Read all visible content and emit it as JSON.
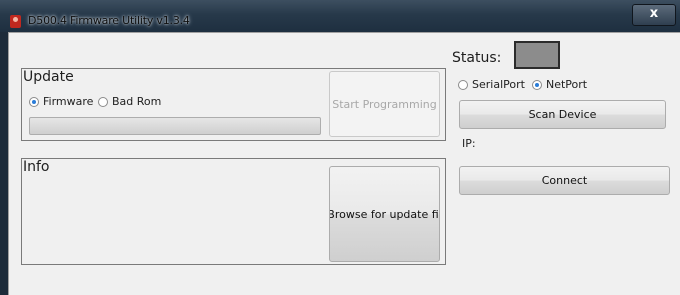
{
  "window": {
    "title": "D500.4 Firmware Utility v1.3.4",
    "close_glyph": "x"
  },
  "update": {
    "title": "Update",
    "radios": [
      {
        "label": "Firmware",
        "selected": true
      },
      {
        "label": "Bad Rom",
        "selected": false
      }
    ],
    "progress": 0,
    "start_button": "Start Programming"
  },
  "info": {
    "title": "Info",
    "browse_button": "Browse for update fil"
  },
  "status": {
    "label": "Status:",
    "indicator_color": "#8c8c8c"
  },
  "connection": {
    "radios": [
      {
        "label": "SerialPort",
        "selected": false
      },
      {
        "label": "NetPort",
        "selected": true
      }
    ],
    "scan_button": "Scan Device",
    "ip_label": "IP:",
    "connect_button": "Connect"
  }
}
